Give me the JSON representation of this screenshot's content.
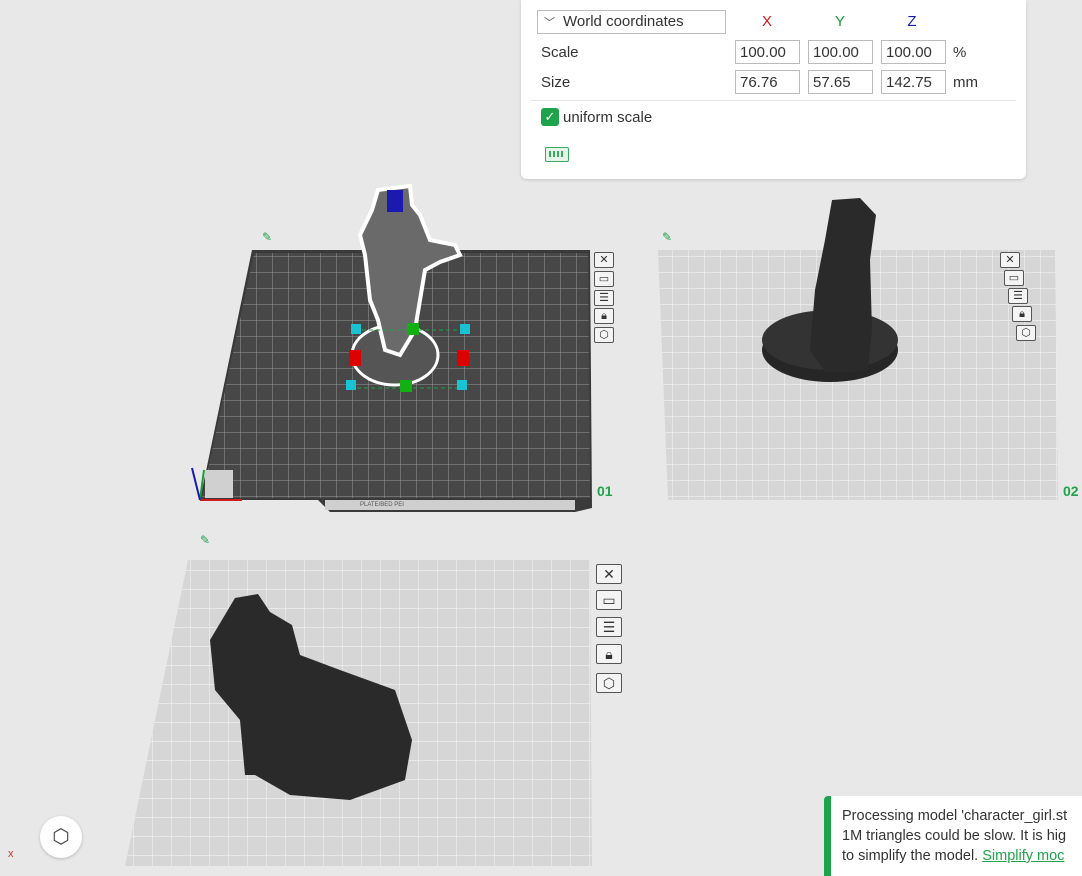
{
  "panel": {
    "coordinate_system": "World coordinates",
    "axes": {
      "x": "X",
      "y": "Y",
      "z": "Z"
    },
    "scale": {
      "label": "Scale",
      "x": "100.00",
      "y": "100.00",
      "z": "100.00",
      "unit": "%"
    },
    "size": {
      "label": "Size",
      "x": "76.76",
      "y": "57.65",
      "z": "142.75",
      "unit": "mm"
    },
    "uniform_scale": {
      "label": "uniform scale",
      "checked": true
    }
  },
  "plates": [
    {
      "number": "01"
    },
    {
      "number": "02"
    }
  ],
  "plate_label": "PLATE/BED PEI",
  "toast": {
    "line1": "Processing model 'character_girl.st",
    "line2": "1M triangles could be slow. It is hig",
    "line3": "to simplify the model. ",
    "link": "Simplify moc"
  },
  "colors": {
    "accent": "#1fa34a",
    "x": "#d11a1a",
    "y": "#1a9a3a",
    "z": "#1a1ab0"
  },
  "corner_mark": "x"
}
